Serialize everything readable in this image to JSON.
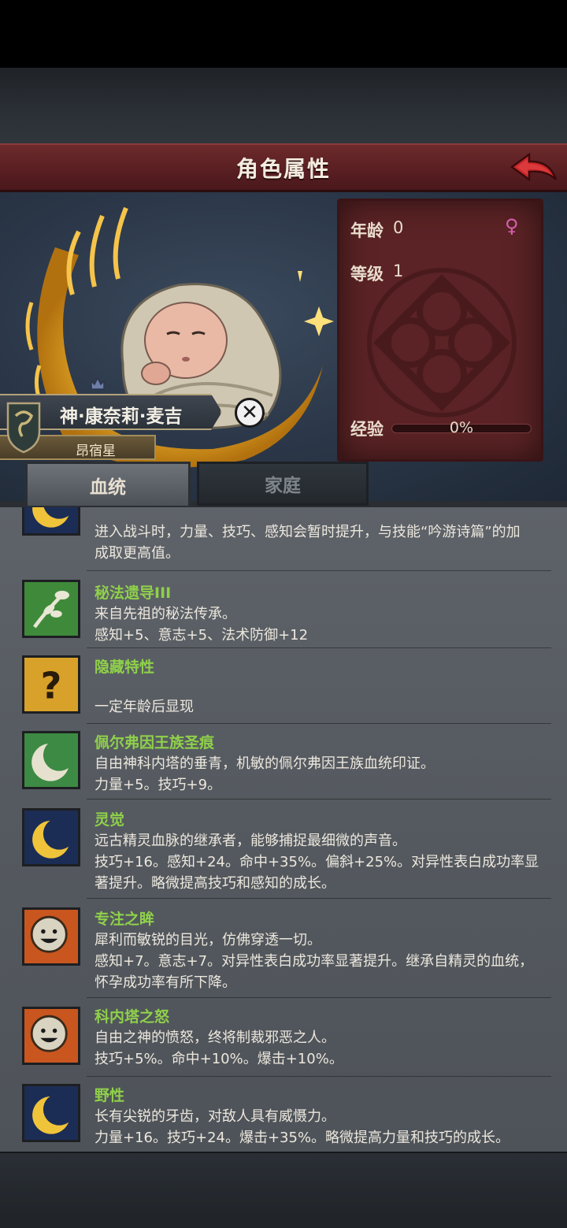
{
  "header": {
    "title": "角色属性",
    "back_icon": "back-arrow-icon"
  },
  "character": {
    "name": "神·康奈莉·麦吉",
    "star": "昂宿星",
    "age_label": "年龄",
    "age_value": "0",
    "level_label": "等级",
    "level_value": "1",
    "exp_label": "经验",
    "exp_value": "0%",
    "exp_fraction": 0,
    "gender_icon": "female-symbol-icon"
  },
  "tabs": [
    {
      "label": "血统",
      "active": true
    },
    {
      "label": "家庭",
      "active": false
    }
  ],
  "traits": [
    {
      "name": "",
      "icon": "moon-crest-icon",
      "desc1": "进入战斗时，力量、技巧、感知会暂时提升，与技能“吟游诗篇”的加",
      "desc2": "成取更高值。"
    },
    {
      "name": "秘法遗导III",
      "icon": "branch-icon",
      "desc1": "来自先祖的秘法传承。",
      "desc2": "感知+5、意志+5、法术防御+12"
    },
    {
      "name": "隐藏特性",
      "icon": "question-mark-icon",
      "desc1": "",
      "desc2": "一定年龄后显现"
    },
    {
      "name": "佩尔弗因王族圣痕",
      "icon": "crescent-claw-icon",
      "desc1": "自由神科内塔的垂青，机敏的佩尔弗因王族血统印证。",
      "desc2": "力量+5。技巧+9。"
    },
    {
      "name": "灵觉",
      "icon": "moon-crest-icon",
      "desc1": "远古精灵血脉的继承者，能够捕捉最细微的声音。",
      "desc2": "技巧+16。感知+24。命中+35%。偏斜+25%。对异性表白成功率显",
      "desc3": "著提升。略微提高技巧和感知的成长。"
    },
    {
      "name": "专注之眸",
      "icon": "sun-face-icon",
      "desc1": "犀利而敏锐的目光，仿佛穿透一切。",
      "desc2": "感知+7。意志+7。对异性表白成功率显著提升。继承自精灵的血统，",
      "desc3": "怀孕成功率有所下降。"
    },
    {
      "name": "科内塔之怒",
      "icon": "sun-face-icon",
      "desc1": "自由之神的愤怒，终将制裁邪恶之人。",
      "desc2": "技巧+5%。命中+10%。爆击+10%。"
    },
    {
      "name": "野性",
      "icon": "moon-crest-icon",
      "desc1": "长有尖锐的牙齿，对敌人具有威慑力。",
      "desc2": "力量+16。技巧+24。爆击+35%。略微提高力量和技巧的成长。"
    }
  ],
  "colors": {
    "trait_name": "#8fd04a",
    "title_bar": "#5a1f22",
    "panel": "#5b2325",
    "gender": "#d65fb0"
  }
}
